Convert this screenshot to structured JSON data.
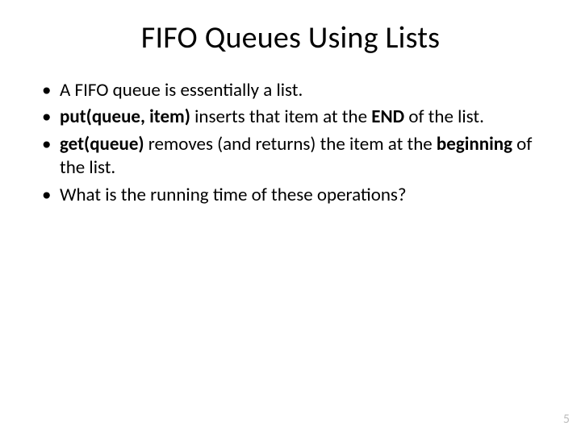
{
  "title": "FIFO Queues Using Lists",
  "bullets": {
    "b1": "A FIFO queue is essentially a list.",
    "b2_bold": "put(queue, item)",
    "b2_a": " inserts that item at the ",
    "b2_end": "END",
    "b2_b": " of the list.",
    "b3_bold": "get(queue)",
    "b3_a": " removes (and returns) the item at the ",
    "b3_beg": "beginning",
    "b3_b": " of the list.",
    "b4": "What is the running time of these operations?"
  },
  "page_number": "5"
}
